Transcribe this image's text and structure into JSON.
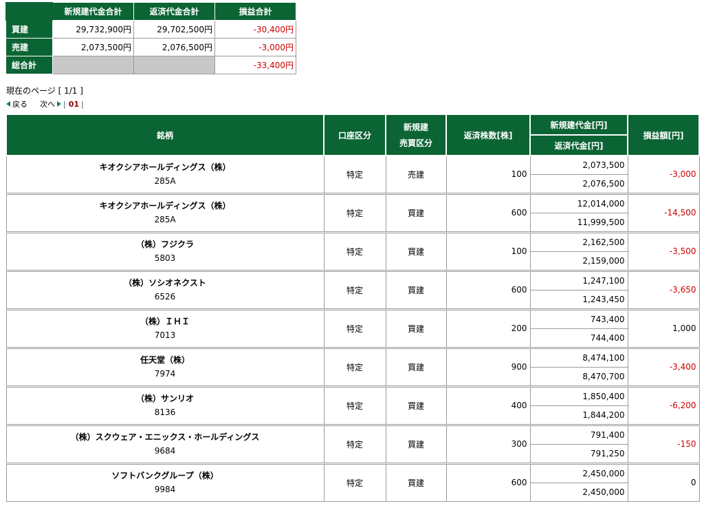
{
  "summary": {
    "headers": [
      "新規建代金合計",
      "返済代金合計",
      "損益合計"
    ],
    "rows": [
      {
        "label": "買建",
        "new_total": "29,732,900円",
        "repay_total": "29,702,500円",
        "pl_total": "-30,400円"
      },
      {
        "label": "売建",
        "new_total": "2,073,500円",
        "repay_total": "2,076,500円",
        "pl_total": "-3,000円"
      }
    ],
    "grand": {
      "label": "総合計",
      "pl_total": "-33,400円"
    }
  },
  "paging": {
    "current_page": "現在のページ [ 1/1 ]",
    "prev": "戻る",
    "next": "次へ",
    "page_num": "01"
  },
  "table": {
    "headers": {
      "name": "銘柄",
      "account": "口座区分",
      "side_line1": "新規建",
      "side_line2": "売買区分",
      "qty": "返済株数[株]",
      "new_amount": "新規建代金[円]",
      "repay_amount": "返済代金[円]",
      "pl": "損益額[円]"
    },
    "rows": [
      {
        "name": "キオクシアホールディングス（株）",
        "code": "285A",
        "account": "特定",
        "side": "売建",
        "qty": "100",
        "new_amount": "2,073,500",
        "repay_amount": "2,076,500",
        "pl": "-3,000"
      },
      {
        "name": "キオクシアホールディングス（株）",
        "code": "285A",
        "account": "特定",
        "side": "買建",
        "qty": "600",
        "new_amount": "12,014,000",
        "repay_amount": "11,999,500",
        "pl": "-14,500"
      },
      {
        "name": "（株）フジクラ",
        "code": "5803",
        "account": "特定",
        "side": "買建",
        "qty": "100",
        "new_amount": "2,162,500",
        "repay_amount": "2,159,000",
        "pl": "-3,500"
      },
      {
        "name": "（株）ソシオネクスト",
        "code": "6526",
        "account": "特定",
        "side": "買建",
        "qty": "600",
        "new_amount": "1,247,100",
        "repay_amount": "1,243,450",
        "pl": "-3,650"
      },
      {
        "name": "（株）ＩＨＩ",
        "code": "7013",
        "account": "特定",
        "side": "買建",
        "qty": "200",
        "new_amount": "743,400",
        "repay_amount": "744,400",
        "pl": "1,000"
      },
      {
        "name": "任天堂（株）",
        "code": "7974",
        "account": "特定",
        "side": "買建",
        "qty": "900",
        "new_amount": "8,474,100",
        "repay_amount": "8,470,700",
        "pl": "-3,400"
      },
      {
        "name": "（株）サンリオ",
        "code": "8136",
        "account": "特定",
        "side": "買建",
        "qty": "400",
        "new_amount": "1,850,400",
        "repay_amount": "1,844,200",
        "pl": "-6,200"
      },
      {
        "name": "（株）スクウェア・エニックス・ホールディングス",
        "code": "9684",
        "account": "特定",
        "side": "買建",
        "qty": "300",
        "new_amount": "791,400",
        "repay_amount": "791,250",
        "pl": "-150"
      },
      {
        "name": "ソフトバンクグループ（株）",
        "code": "9984",
        "account": "特定",
        "side": "買建",
        "qty": "600",
        "new_amount": "2,450,000",
        "repay_amount": "2,450,000",
        "pl": "0"
      }
    ]
  },
  "colors": {
    "header_green": "#0b6433",
    "negative_red": "#cc0000"
  }
}
